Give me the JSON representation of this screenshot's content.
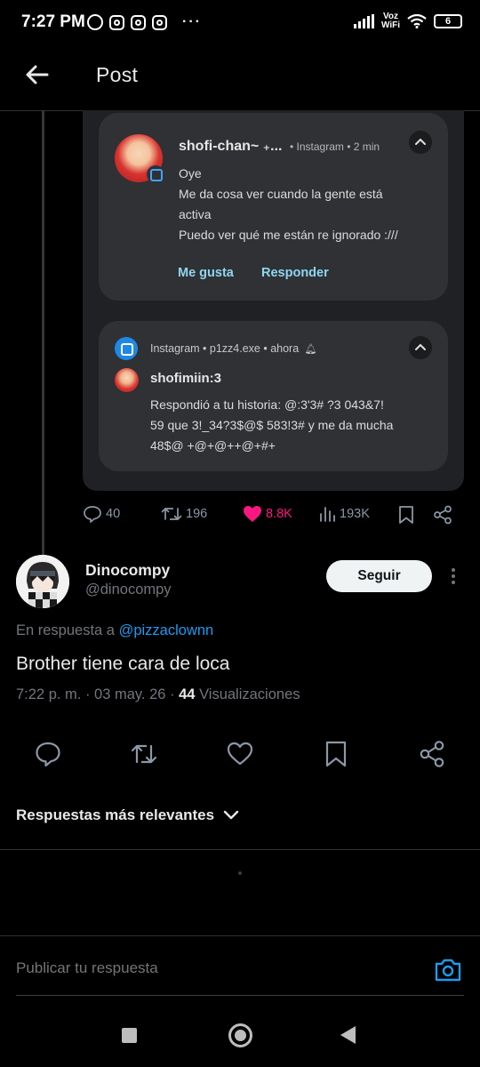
{
  "status_bar": {
    "time": "7:27 PM",
    "network_label_top": "Voz",
    "network_label_bottom": "WiFi",
    "battery": "6",
    "more": "···"
  },
  "header": {
    "title": "Post"
  },
  "image": {
    "notification1": {
      "name": "shofi-chan~ ₊...",
      "meta": "• Instagram • 2 min",
      "lines": [
        "Oye",
        "Me da cosa ver cuando la gente está",
        "activa",
        "Puedo ver qué me están re ignorado :///"
      ],
      "like_action": "Me gusta",
      "reply_action": "Responder"
    },
    "notification2": {
      "meta": "Instagram • p1zz4.exe • ahora",
      "name": "shofimiin:3",
      "lines": [
        "Respondió a tu historia: @:3'3# ?3 043&7!",
        "59 que 3!_34?3$@$ 583!3# y me da mucha",
        "48$@ +@+@++@+#+"
      ]
    }
  },
  "metrics": {
    "replies": "40",
    "reposts": "196",
    "likes": "8.8K",
    "views": "193K"
  },
  "reply": {
    "author_name": "Dinocompy",
    "author_handle": "@dinocompy",
    "follow_label": "Seguir",
    "reply_to_prefix": "En respuesta a",
    "reply_to_mention": "@pizzaclownn",
    "text": "Brother tiene cara de loca",
    "meta_time": "7:22 p. m. · 03 may. 26 ·",
    "views_count": "44",
    "views_label": "Visualizaciones"
  },
  "sort": {
    "label": "Respuestas más relevantes"
  },
  "compose": {
    "placeholder": "Publicar tu respuesta"
  },
  "colors": {
    "like": "#f91880",
    "link": "#1d9bf0",
    "camera": "#1d9bf0"
  }
}
